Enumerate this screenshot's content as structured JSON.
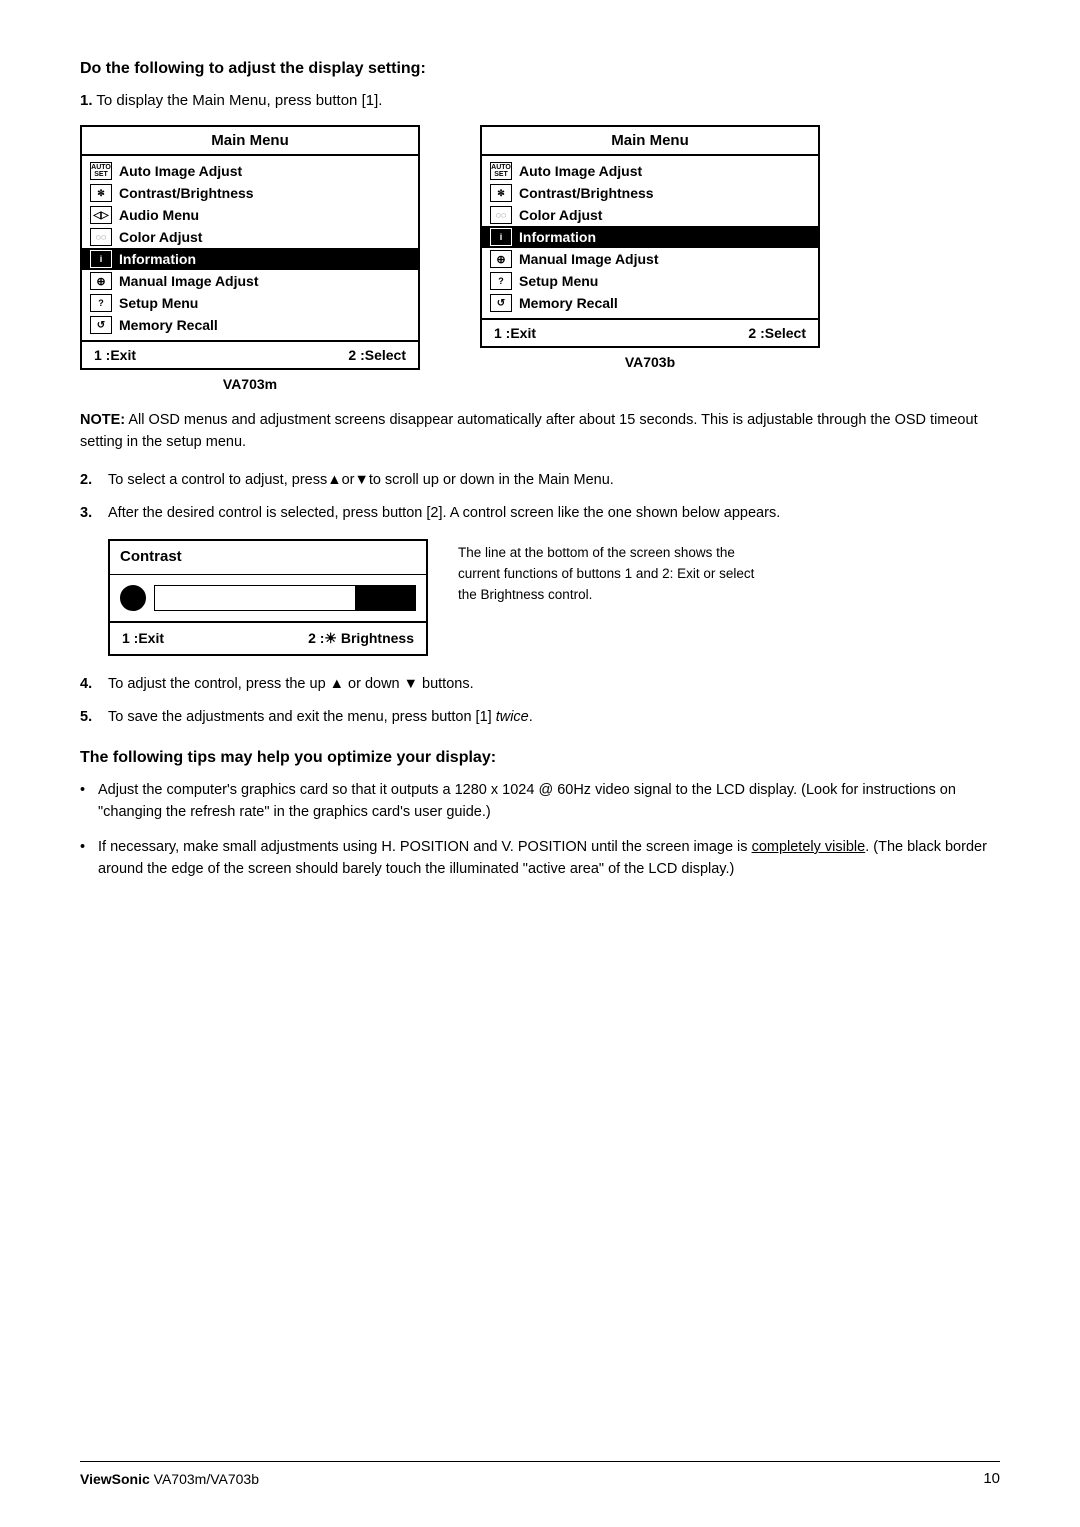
{
  "page": {
    "heading": "Do the following to adjust the display setting:",
    "step1_text": "To display the Main Menu, press button [1].",
    "menu_left": {
      "title": "Main Menu",
      "items": [
        {
          "icon": "AUTO\nSET",
          "label": "Auto Image Adjust",
          "selected": false
        },
        {
          "icon": "✼",
          "label": "Contrast/Brightness",
          "selected": false
        },
        {
          "icon": "◁▷",
          "label": "Audio Menu",
          "selected": false
        },
        {
          "icon": "◌◌",
          "label": "Color Adjust",
          "selected": false
        },
        {
          "icon": "i",
          "label": "Information",
          "selected": true
        },
        {
          "icon": "⊕",
          "label": "Manual Image Adjust",
          "selected": false
        },
        {
          "icon": "?",
          "label": "Setup Menu",
          "selected": false
        },
        {
          "icon": "↺",
          "label": "Memory Recall",
          "selected": false
        }
      ],
      "footer_left": "1 :Exit",
      "footer_right": "2 :Select",
      "model": "VA703m"
    },
    "menu_right": {
      "title": "Main Menu",
      "items": [
        {
          "icon": "AUTO\nSET",
          "label": "Auto Image Adjust",
          "selected": false
        },
        {
          "icon": "✼",
          "label": "Contrast/Brightness",
          "selected": false
        },
        {
          "icon": "◌◌",
          "label": "Color Adjust",
          "selected": false
        },
        {
          "icon": "i",
          "label": "Information",
          "selected": true
        },
        {
          "icon": "⊕",
          "label": "Manual Image Adjust",
          "selected": false
        },
        {
          "icon": "?",
          "label": "Setup Menu",
          "selected": false
        },
        {
          "icon": "↺",
          "label": "Memory Recall",
          "selected": false
        }
      ],
      "footer_left": "1 :Exit",
      "footer_right": "2 :Select",
      "model": "VA703b"
    },
    "note": "NOTE: All OSD menus and adjustment screens disappear automatically after about 15 seconds. This is adjustable through the OSD timeout setting in the setup menu.",
    "step2_text": "To select a control to adjust, press▲or▼to scroll up or down in the Main Menu.",
    "step3_text": "After the desired control is selected, press button [2]. A control screen like the one shown below appears.",
    "contrast_box": {
      "title": "Contrast",
      "footer_left": "1 :Exit",
      "footer_right": "2 :☀ Brightness"
    },
    "contrast_note": "The line at the bottom of the screen shows the current functions of buttons 1 and 2: Exit or select the Brightness control.",
    "step4_text": "To adjust the control, press the up ▲ or down ▼ buttons.",
    "step5_text": "To save the adjustments and exit the menu, press button [1] twice.",
    "step5_italic": "twice",
    "tips_heading": "The following tips may help you optimize your display:",
    "tip1": "Adjust the computer's graphics card so that it outputs a 1280 x 1024 @ 60Hz video signal to the LCD display. (Look for instructions on \"changing the refresh rate\" in the graphics card's user guide.)",
    "tip2_before": "If necessary, make small adjustments using H. POSITION and V. POSITION until the screen image is ",
    "tip2_underline": "completely visible",
    "tip2_after": ". (The black border around the edge of the screen should barely touch the illuminated \"active area\" of the LCD display.)",
    "footer_brand": "ViewSonic",
    "footer_model": "VA703m/VA703b",
    "footer_page": "10"
  }
}
